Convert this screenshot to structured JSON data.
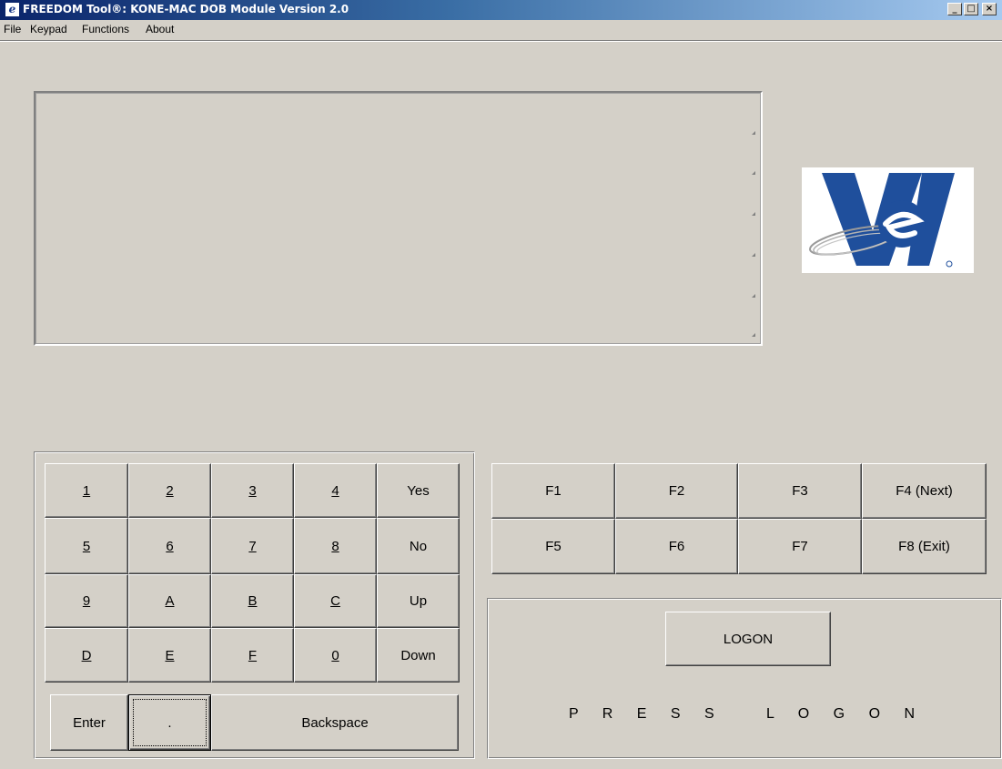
{
  "window": {
    "title": "FREEDOM Tool®:  KONE-MAC DOB Module Version 2.0",
    "app_icon_letter": "e",
    "minimize_glyph": "_",
    "maximize_glyph": "□",
    "close_glyph": "×"
  },
  "menu": {
    "file": "File",
    "keypad": "Keypad",
    "functions": "Functions",
    "about": "About"
  },
  "keypad": {
    "row1": [
      "1",
      "2",
      "3",
      "4",
      "Yes"
    ],
    "row2": [
      "5",
      "6",
      "7",
      "8",
      "No"
    ],
    "row3": [
      "9",
      "A",
      "B",
      "C",
      "Up"
    ],
    "row4": [
      "D",
      "E",
      "F",
      "0",
      "Down"
    ],
    "enter": "Enter",
    "dot": ".",
    "backspace": "Backspace"
  },
  "function_keys": {
    "row1": [
      "F1",
      "F2",
      "F3",
      "F4 (Next)"
    ],
    "row2": [
      "F5",
      "F6",
      "F7",
      "F8 (Exit)"
    ]
  },
  "logon": {
    "button": "LOGON",
    "status": "P R E S S   L O G O N"
  },
  "logo": {
    "name": "ve-logo",
    "colors": {
      "blue": "#1f4f9c",
      "swoosh": "#9a9a9a"
    }
  }
}
